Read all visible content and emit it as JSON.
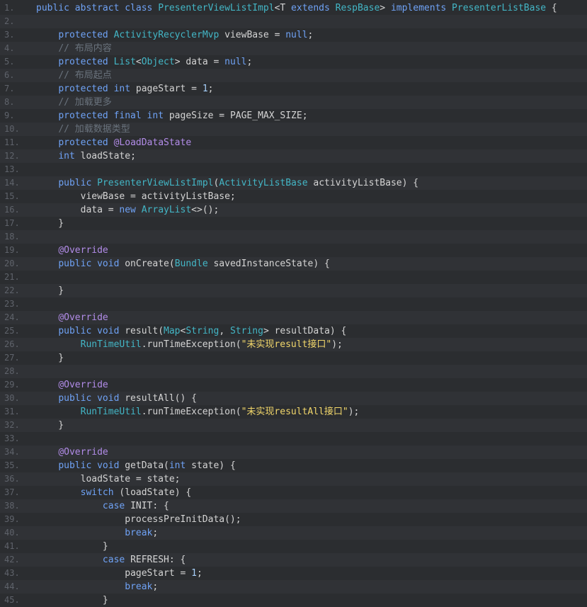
{
  "colors": {
    "background": "#2b2d30",
    "line_number": "#5f636b",
    "keyword": "#6fa2f5",
    "plain": "#d4d4d4",
    "type": "#43b6c6",
    "number": "#a7d0fb",
    "comment": "#6a737d",
    "annotation": "#b28ce8",
    "string": "#f2d76b"
  },
  "lines": [
    {
      "n": "1.",
      "tokens": [
        [
          "kw",
          "public abstract class "
        ],
        [
          "ty",
          "PresenterViewListImpl"
        ],
        [
          "pl",
          "<T "
        ],
        [
          "kw",
          "extends "
        ],
        [
          "ty",
          "RespBase"
        ],
        [
          "pl",
          "> "
        ],
        [
          "kw",
          "implements "
        ],
        [
          "ty",
          "PresenterListBase"
        ],
        [
          "pl",
          " {"
        ]
      ]
    },
    {
      "n": "2.",
      "tokens": []
    },
    {
      "n": "3.",
      "tokens": [
        [
          "pl",
          "    "
        ],
        [
          "kw",
          "protected "
        ],
        [
          "ty",
          "ActivityRecyclerMvp"
        ],
        [
          "pl",
          " viewBase = "
        ],
        [
          "kw",
          "null"
        ],
        [
          "pl",
          ";"
        ]
      ]
    },
    {
      "n": "4.",
      "tokens": [
        [
          "pl",
          "    "
        ],
        [
          "cm",
          "// 布局内容"
        ]
      ]
    },
    {
      "n": "5.",
      "tokens": [
        [
          "pl",
          "    "
        ],
        [
          "kw",
          "protected "
        ],
        [
          "ty",
          "List"
        ],
        [
          "pl",
          "<"
        ],
        [
          "ty",
          "Object"
        ],
        [
          "pl",
          "> data = "
        ],
        [
          "kw",
          "null"
        ],
        [
          "pl",
          ";"
        ]
      ]
    },
    {
      "n": "6.",
      "tokens": [
        [
          "pl",
          "    "
        ],
        [
          "cm",
          "// 布局起点"
        ]
      ]
    },
    {
      "n": "7.",
      "tokens": [
        [
          "pl",
          "    "
        ],
        [
          "kw",
          "protected int "
        ],
        [
          "pl",
          "pageStart = "
        ],
        [
          "nu",
          "1"
        ],
        [
          "pl",
          ";"
        ]
      ]
    },
    {
      "n": "8.",
      "tokens": [
        [
          "pl",
          "    "
        ],
        [
          "cm",
          "// 加载更多"
        ]
      ]
    },
    {
      "n": "9.",
      "tokens": [
        [
          "pl",
          "    "
        ],
        [
          "kw",
          "protected final int "
        ],
        [
          "pl",
          "pageSize = PAGE_MAX_SIZE;"
        ]
      ]
    },
    {
      "n": "10.",
      "tokens": [
        [
          "pl",
          "    "
        ],
        [
          "cm",
          "// 加载数据类型"
        ]
      ]
    },
    {
      "n": "11.",
      "tokens": [
        [
          "pl",
          "    "
        ],
        [
          "kw",
          "protected "
        ],
        [
          "an",
          "@LoadDataState"
        ]
      ]
    },
    {
      "n": "12.",
      "tokens": [
        [
          "pl",
          "    "
        ],
        [
          "kw",
          "int "
        ],
        [
          "pl",
          "loadState;"
        ]
      ]
    },
    {
      "n": "13.",
      "tokens": []
    },
    {
      "n": "14.",
      "tokens": [
        [
          "pl",
          "    "
        ],
        [
          "kw",
          "public "
        ],
        [
          "ty",
          "PresenterViewListImpl"
        ],
        [
          "pl",
          "("
        ],
        [
          "ty",
          "ActivityListBase"
        ],
        [
          "pl",
          " activityListBase) {"
        ]
      ]
    },
    {
      "n": "15.",
      "tokens": [
        [
          "pl",
          "        viewBase = activityListBase;"
        ]
      ]
    },
    {
      "n": "16.",
      "tokens": [
        [
          "pl",
          "        data = "
        ],
        [
          "kw",
          "new "
        ],
        [
          "ty",
          "ArrayList"
        ],
        [
          "pl",
          "<>();"
        ]
      ]
    },
    {
      "n": "17.",
      "tokens": [
        [
          "pl",
          "    }"
        ]
      ]
    },
    {
      "n": "18.",
      "tokens": []
    },
    {
      "n": "19.",
      "tokens": [
        [
          "pl",
          "    "
        ],
        [
          "an",
          "@Override"
        ]
      ]
    },
    {
      "n": "20.",
      "tokens": [
        [
          "pl",
          "    "
        ],
        [
          "kw",
          "public void "
        ],
        [
          "pl",
          "onCreate("
        ],
        [
          "ty",
          "Bundle"
        ],
        [
          "pl",
          " savedInstanceState) {"
        ]
      ]
    },
    {
      "n": "21.",
      "tokens": []
    },
    {
      "n": "22.",
      "tokens": [
        [
          "pl",
          "    }"
        ]
      ]
    },
    {
      "n": "23.",
      "tokens": []
    },
    {
      "n": "24.",
      "tokens": [
        [
          "pl",
          "    "
        ],
        [
          "an",
          "@Override"
        ]
      ]
    },
    {
      "n": "25.",
      "tokens": [
        [
          "pl",
          "    "
        ],
        [
          "kw",
          "public void "
        ],
        [
          "pl",
          "result("
        ],
        [
          "ty",
          "Map"
        ],
        [
          "pl",
          "<"
        ],
        [
          "ty",
          "String"
        ],
        [
          "pl",
          ", "
        ],
        [
          "ty",
          "String"
        ],
        [
          "pl",
          "> resultData) {"
        ]
      ]
    },
    {
      "n": "26.",
      "tokens": [
        [
          "pl",
          "        "
        ],
        [
          "ty",
          "RunTimeUtil"
        ],
        [
          "pl",
          ".runTimeException("
        ],
        [
          "st",
          "\"未实现result接口\""
        ],
        [
          "pl",
          ");"
        ]
      ]
    },
    {
      "n": "27.",
      "tokens": [
        [
          "pl",
          "    }"
        ]
      ]
    },
    {
      "n": "28.",
      "tokens": []
    },
    {
      "n": "29.",
      "tokens": [
        [
          "pl",
          "    "
        ],
        [
          "an",
          "@Override"
        ]
      ]
    },
    {
      "n": "30.",
      "tokens": [
        [
          "pl",
          "    "
        ],
        [
          "kw",
          "public void "
        ],
        [
          "pl",
          "resultAll() {"
        ]
      ]
    },
    {
      "n": "31.",
      "tokens": [
        [
          "pl",
          "        "
        ],
        [
          "ty",
          "RunTimeUtil"
        ],
        [
          "pl",
          ".runTimeException("
        ],
        [
          "st",
          "\"未实现resultAll接口\""
        ],
        [
          "pl",
          ");"
        ]
      ]
    },
    {
      "n": "32.",
      "tokens": [
        [
          "pl",
          "    }"
        ]
      ]
    },
    {
      "n": "33.",
      "tokens": []
    },
    {
      "n": "34.",
      "tokens": [
        [
          "pl",
          "    "
        ],
        [
          "an",
          "@Override"
        ]
      ]
    },
    {
      "n": "35.",
      "tokens": [
        [
          "pl",
          "    "
        ],
        [
          "kw",
          "public void "
        ],
        [
          "pl",
          "getData("
        ],
        [
          "kw",
          "int "
        ],
        [
          "pl",
          "state) {"
        ]
      ]
    },
    {
      "n": "36.",
      "tokens": [
        [
          "pl",
          "        loadState = state;"
        ]
      ]
    },
    {
      "n": "37.",
      "tokens": [
        [
          "pl",
          "        "
        ],
        [
          "kw",
          "switch "
        ],
        [
          "pl",
          "(loadState) {"
        ]
      ]
    },
    {
      "n": "38.",
      "tokens": [
        [
          "pl",
          "            "
        ],
        [
          "kw",
          "case "
        ],
        [
          "pl",
          "INIT: {"
        ]
      ]
    },
    {
      "n": "39.",
      "tokens": [
        [
          "pl",
          "                processPreInitData();"
        ]
      ]
    },
    {
      "n": "40.",
      "tokens": [
        [
          "pl",
          "                "
        ],
        [
          "kw",
          "break"
        ],
        [
          "pl",
          ";"
        ]
      ]
    },
    {
      "n": "41.",
      "tokens": [
        [
          "pl",
          "            }"
        ]
      ]
    },
    {
      "n": "42.",
      "tokens": [
        [
          "pl",
          "            "
        ],
        [
          "kw",
          "case "
        ],
        [
          "pl",
          "REFRESH: {"
        ]
      ]
    },
    {
      "n": "43.",
      "tokens": [
        [
          "pl",
          "                pageStart = "
        ],
        [
          "nu",
          "1"
        ],
        [
          "pl",
          ";"
        ]
      ]
    },
    {
      "n": "44.",
      "tokens": [
        [
          "pl",
          "                "
        ],
        [
          "kw",
          "break"
        ],
        [
          "pl",
          ";"
        ]
      ]
    },
    {
      "n": "45.",
      "tokens": [
        [
          "pl",
          "            }"
        ]
      ]
    }
  ]
}
